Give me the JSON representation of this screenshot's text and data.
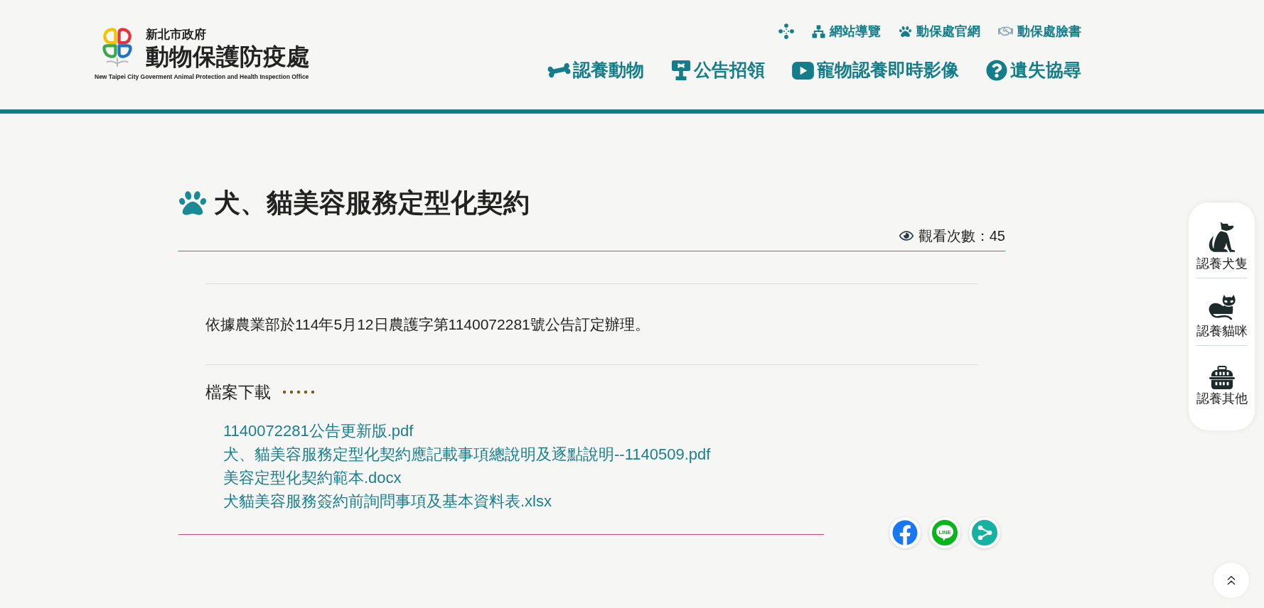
{
  "header": {
    "logo": {
      "agency": "新北市政府",
      "name": "動物保護防疫處",
      "english_name": "New Taipei City Goverment Animal Protection and Health Inspection Office"
    },
    "utility_links": [
      {
        "kind": "sitemap",
        "label": "網站導覽"
      },
      {
        "kind": "paw",
        "label": "動保處官網"
      },
      {
        "kind": "handshake",
        "label": "動保處臉書"
      }
    ],
    "main_nav": [
      {
        "kind": "bone",
        "label": "認養動物"
      },
      {
        "kind": "signboard",
        "label": "公告招領"
      },
      {
        "kind": "video",
        "label": "寵物認養即時影像"
      },
      {
        "kind": "question",
        "label": "遺失協尋"
      }
    ]
  },
  "article": {
    "title": "犬、貓美容服務定型化契約",
    "view_count": "觀看次數：45",
    "body": "依據農業部於114年5月12日農護字第1140072281號公告訂定辦理。",
    "downloads": {
      "heading": "檔案下載",
      "files": [
        "1140072281公告更新版.pdf",
        "犬、貓美容服務定型化契約應記載事項總說明及逐點說明--1140509.pdf",
        "美容定型化契約範本.docx",
        "犬貓美容服務簽約前詢問事項及基本資料表.xlsx"
      ]
    }
  },
  "share_buttons": [
    {
      "kind": "facebook"
    },
    {
      "kind": "line",
      "logo_text": "LINE"
    },
    {
      "kind": "share"
    }
  ],
  "quick_links": [
    {
      "kind": "dog",
      "label": "認養犬隻"
    },
    {
      "kind": "cat",
      "label": "認養貓咪"
    },
    {
      "kind": "carrier",
      "label": "認養其他"
    }
  ]
}
